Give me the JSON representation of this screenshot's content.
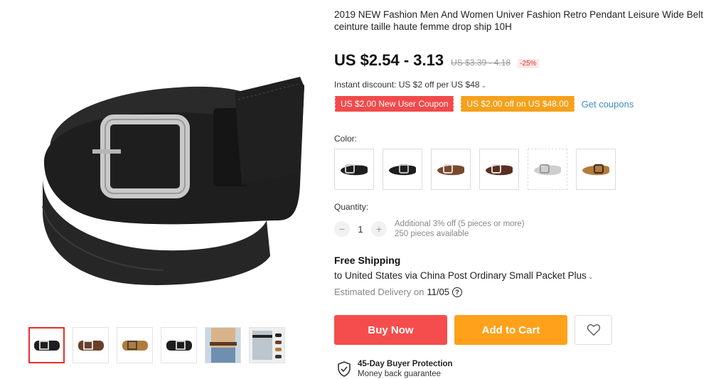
{
  "product": {
    "title": "2019 NEW Fashion Men And Women Univer Fashion Retro Pendant Leisure Wide Belt ceinture taille haute femme drop ship 10H",
    "price": "US $2.54 - 3.13",
    "original_price": "US $3.39 - 4.18",
    "discount_badge": "-25%"
  },
  "discount": {
    "instant_text": "Instant discount: US $2 off per US $48"
  },
  "coupons": {
    "new_user": "US $2.00 New User Coupon",
    "store": "US $2.00 off on US $48.00",
    "get_link": "Get coupons"
  },
  "color": {
    "label": "Color:",
    "selected_index": null,
    "options": [
      "black belt silver buckle",
      "black belt square buckle",
      "brown belt",
      "dark brown belt",
      "grey belt",
      "tan belt"
    ]
  },
  "quantity": {
    "label": "Quantity:",
    "value": "1",
    "minus": "−",
    "plus": "+",
    "additional": "Additional 3% off (5 pieces or more)",
    "available": "250 pieces available"
  },
  "shipping": {
    "title": "Free Shipping",
    "to": "to United States via China Post Ordinary Small Packet Plus",
    "delivery_prefix": "Estimated Delivery on",
    "delivery_date": "11/05"
  },
  "actions": {
    "buy_now": "Buy Now",
    "add_to_cart": "Add to Cart"
  },
  "protection": {
    "title": "45-Day Buyer Protection",
    "subtitle": "Money back guarantee"
  },
  "gallery": {
    "active_index": 0,
    "thumb_count": 6
  },
  "colors": {
    "price": "#111111",
    "buy_now": "#f54d4d",
    "add_to_cart": "#ffa11b",
    "coupon_red": "#f24a4a",
    "coupon_orange": "#f5a11a",
    "link": "#3e8cc6",
    "active_border": "#e62e2e"
  },
  "icons": {
    "chevron": "chevron-down-icon",
    "help": "question-circle-icon",
    "wishlist": "heart-outline-icon",
    "protection": "shield-check-icon"
  }
}
